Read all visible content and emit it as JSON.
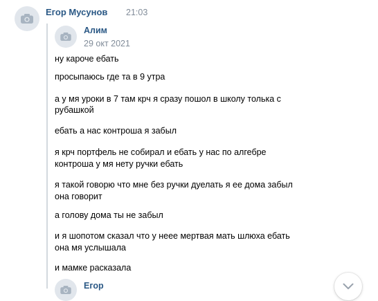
{
  "message": {
    "author": "Егор Мусунов",
    "time": "21:03",
    "avatar_icon": "camera-icon",
    "forwarded": [
      {
        "author": "Алим",
        "date": "29 окт 2021",
        "avatar_icon": "camera-icon",
        "lines": [
          "ну кароче ебать",
          "просыпаюсь где та в 9 утра",
          "а у мя уроки в 7 там крч я сразу пошол в школу толька с",
          "рубашкой",
          "ебать а нас контроша я забыл",
          "я крч портфель не собирал и ебать у нас по алгебре",
          "контроша у мя нету ручки ебать",
          "я такой говорю что мне без ручки дуелать я ее дома забыл",
          "она говорит",
          "а голову дома ты не забыл",
          "и я шопотом сказал что у неее мертвая мать шлюха ебать",
          "она мя услышала",
          "и мамке расказала"
        ]
      },
      {
        "author": "Егор",
        "avatar_icon": "camera-icon"
      }
    ]
  },
  "scroll_down_icon": "chevron-down-icon",
  "colors": {
    "link": "#2a5885",
    "meta": "#818c99",
    "avatar_bg": "#e1e6ec",
    "avatar_fg": "#a8b4c1",
    "quote_bar": "#d3d9de"
  }
}
